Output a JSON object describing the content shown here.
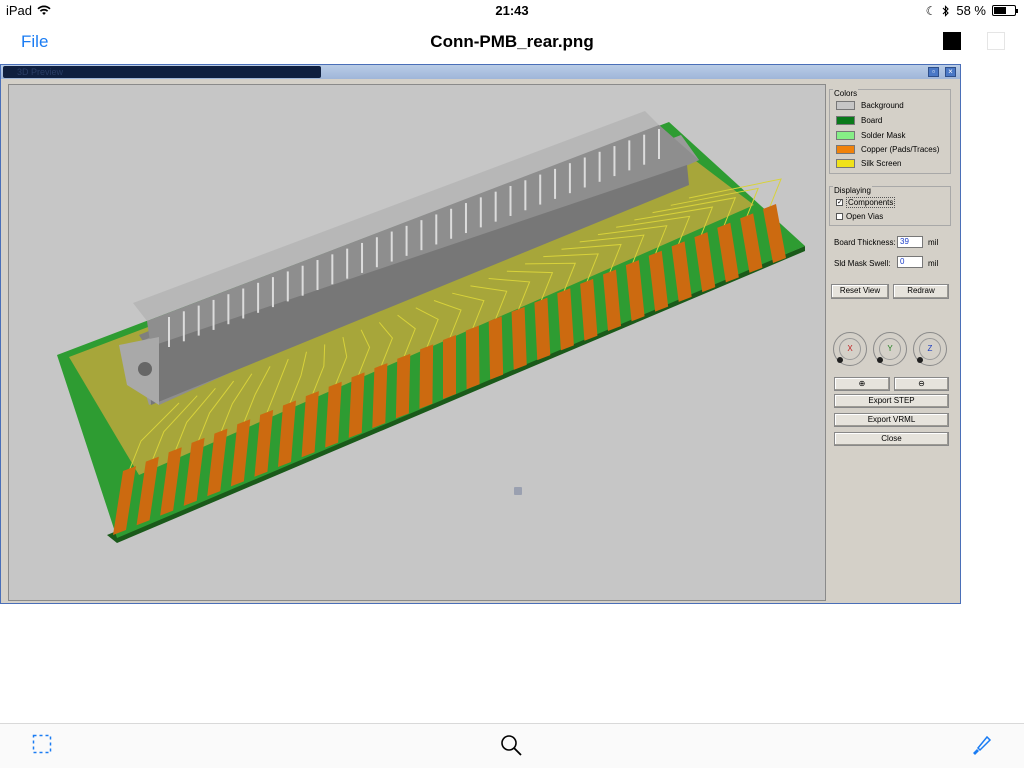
{
  "status_bar": {
    "device": "iPad",
    "time": "21:43",
    "battery_text": "58 %",
    "battery_level": 0.58
  },
  "nav": {
    "file_label": "File",
    "title": "Conn-PMB_rear.png",
    "swatch_dark": "#000000",
    "swatch_light": "#ffffff"
  },
  "window": {
    "title": "3D Preview"
  },
  "panel": {
    "colors_label": "Colors",
    "colors": [
      {
        "label": "Background",
        "color": "#c6c6c6"
      },
      {
        "label": "Board",
        "color": "#0a7a1a"
      },
      {
        "label": "Solder Mask",
        "color": "#86ee86"
      },
      {
        "label": "Copper (Pads/Traces)",
        "color": "#f0820a"
      },
      {
        "label": "Silk Screen",
        "color": "#f0e21a"
      }
    ],
    "displaying_label": "Displaying",
    "components_label": "Components",
    "components_checked": "✓",
    "open_vias_label": "Open Vias",
    "board_thickness_label": "Board Thickness:",
    "board_thickness_value": "39",
    "board_thickness_unit": "mil",
    "mask_swell_label": "Sld Mask Swell:",
    "mask_swell_value": "0",
    "mask_swell_unit": "mil",
    "reset_view_label": "Reset View",
    "redraw_label": "Redraw",
    "dial_x": "X",
    "dial_y": "Y",
    "dial_z": "Z",
    "zoom_in_symbol": "⊕",
    "zoom_out_symbol": "⊖",
    "export_step_label": "Export STEP",
    "export_vrml_label": "Export VRML",
    "close_label": "Close"
  }
}
